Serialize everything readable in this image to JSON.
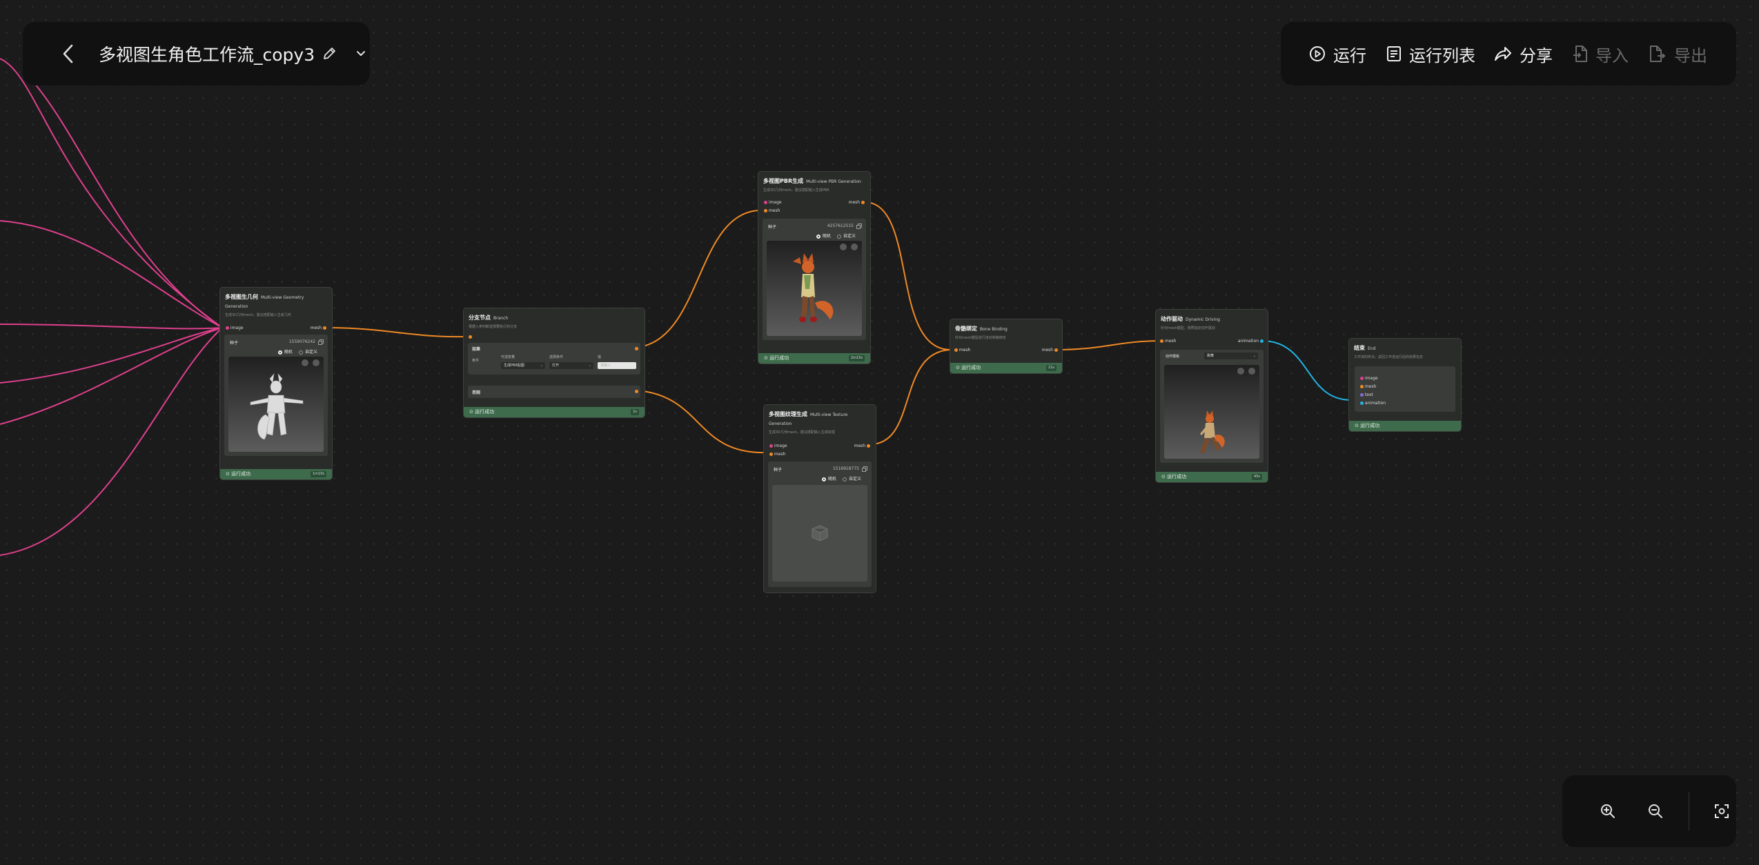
{
  "header": {
    "title": "多视图生角色工作流_copy3"
  },
  "toolbar": {
    "run": "运行",
    "run_list": "运行列表",
    "share": "分享",
    "import": "导入",
    "export": "导出"
  },
  "colors": {
    "canvas_bg": "#1b1b1b",
    "panel_bg": "#111111",
    "node_bg": "#2a2c2a",
    "status_green": "#3e6b4c",
    "wire_pink": "#e0408e",
    "wire_orange": "#f08a24",
    "wire_cyan": "#22b4e4",
    "disabled_text": "#6a6a6a"
  },
  "nodes": {
    "geometry": {
      "title": "多视图生几何",
      "title_en": "Multi-view Geometry Generation",
      "desc": "生成3D几何mesh，建议搭配输入生成几何",
      "in_port": "image",
      "out_port": "mesh",
      "seed_label": "种子",
      "seed_value": "1559076242",
      "random": "随机",
      "custom": "自定义",
      "status": "运行成功",
      "time": "1m10s"
    },
    "branch": {
      "title": "分支节点",
      "title_en": "Branch",
      "desc": "根据入参判断选择要执行的分支",
      "if_label": "如果",
      "cond_label": "条件",
      "col_option": "可选变量",
      "col_select": "选择条件",
      "col_value": "值",
      "option_value": "生成PBR贴图",
      "select_value": "打开",
      "value_placeholder": "请输入",
      "else_label": "否则",
      "status": "运行成功",
      "time": "1s"
    },
    "pbr": {
      "title": "多视图PBR生成",
      "title_en": "Multi-view PBR Generation",
      "desc": "生成3D几何mesh，建议搭配输入生成PBR",
      "in_port1": "image",
      "in_port2": "mesh",
      "out_port": "mesh",
      "seed_label": "种子",
      "seed_value": "4257612515",
      "random": "随机",
      "custom": "自定义",
      "status": "运行成功",
      "time": "2m15s"
    },
    "texture": {
      "title": "多视图纹理生成",
      "title_en": "Multi-view Texture Generation",
      "desc": "生成3D几何mesh，建议搭配输入生成纹理",
      "in_port1": "image",
      "in_port2": "mesh",
      "out_port": "mesh",
      "seed_label": "种子",
      "seed_value": "1516918775",
      "random": "随机",
      "custom": "自定义"
    },
    "bone": {
      "title": "骨骼绑定",
      "title_en": "Bone Binding",
      "desc": "针对mesh模型进行自动骨骼绑定",
      "in_port": "mesh",
      "out_port": "mesh",
      "status": "运行成功",
      "time": "21s"
    },
    "driving": {
      "title": "动作驱动",
      "title_en": "Dynamic Driving",
      "desc": "针对mesh模型，按照指定动作驱动",
      "in_port": "mesh",
      "out_port": "animation",
      "action_label": "动作模板",
      "action_value": "跳舞",
      "status": "运行成功",
      "time": "45s"
    },
    "end": {
      "title": "结束",
      "title_en": "End",
      "desc": "工作流的终点，返回工作流运行后的结果信息",
      "outputs": [
        "image",
        "mesh",
        "text",
        "animation"
      ],
      "status": "运行成功"
    }
  }
}
